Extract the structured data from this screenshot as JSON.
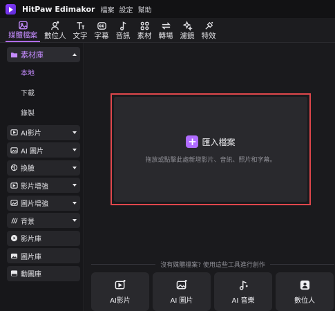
{
  "app": {
    "name": "HitPaw Edimakor",
    "menu": [
      "檔案",
      "設定",
      "幫助"
    ]
  },
  "toolbar": {
    "items": [
      {
        "label": "媒體檔案",
        "icon": "media-icon",
        "active": true
      },
      {
        "label": "數位人",
        "icon": "digital-human-icon"
      },
      {
        "label": "文字",
        "icon": "text-icon"
      },
      {
        "label": "字幕",
        "icon": "subtitle-icon"
      },
      {
        "label": "音訊",
        "icon": "audio-icon"
      },
      {
        "label": "素材",
        "icon": "assets-icon"
      },
      {
        "label": "轉場",
        "icon": "transition-icon"
      },
      {
        "label": "濾鏡",
        "icon": "filter-icon"
      },
      {
        "label": "特效",
        "icon": "effects-icon"
      }
    ]
  },
  "sidebar": {
    "library": {
      "label": "素材庫",
      "icon": "folder-icon",
      "expanded": true
    },
    "sub_items": [
      {
        "label": "本地",
        "active": true
      },
      {
        "label": "下載"
      },
      {
        "label": "錄製"
      }
    ],
    "items": [
      {
        "label": "AI影片",
        "icon": "ai-video-icon",
        "has_dropdown": true
      },
      {
        "label": "AI 圖片",
        "icon": "ai-image-icon",
        "has_dropdown": true
      },
      {
        "label": "換臉",
        "icon": "face-swap-icon",
        "has_dropdown": true
      },
      {
        "label": "影片增強",
        "icon": "video-enhance-icon",
        "has_dropdown": true
      },
      {
        "label": "圖片增強",
        "icon": "image-enhance-icon",
        "has_dropdown": true
      },
      {
        "label": "背景",
        "icon": "background-icon",
        "has_dropdown": true
      },
      {
        "label": "影片庫",
        "icon": "video-library-icon"
      },
      {
        "label": "圖片庫",
        "icon": "image-library-icon"
      },
      {
        "label": "動圖庫",
        "icon": "gif-icon"
      }
    ]
  },
  "drop_zone": {
    "import_label": "匯入檔案",
    "hint": "拖放或點擊此處新增影片、音訊、照片和字幕。"
  },
  "suggest": {
    "text": "沒有媒體檔案? 使用這些工具進行創作",
    "tools": [
      {
        "label": "AI影片",
        "icon": "ai-video-icon"
      },
      {
        "label": "AI 圖片",
        "icon": "ai-image-icon"
      },
      {
        "label": "AI 音樂",
        "icon": "ai-music-icon"
      },
      {
        "label": "數位人",
        "icon": "digital-human-icon"
      }
    ]
  },
  "colors": {
    "accent": "#b06cff",
    "highlight_border": "#e0474c",
    "background": "#17171a",
    "panel": "#29292d"
  }
}
